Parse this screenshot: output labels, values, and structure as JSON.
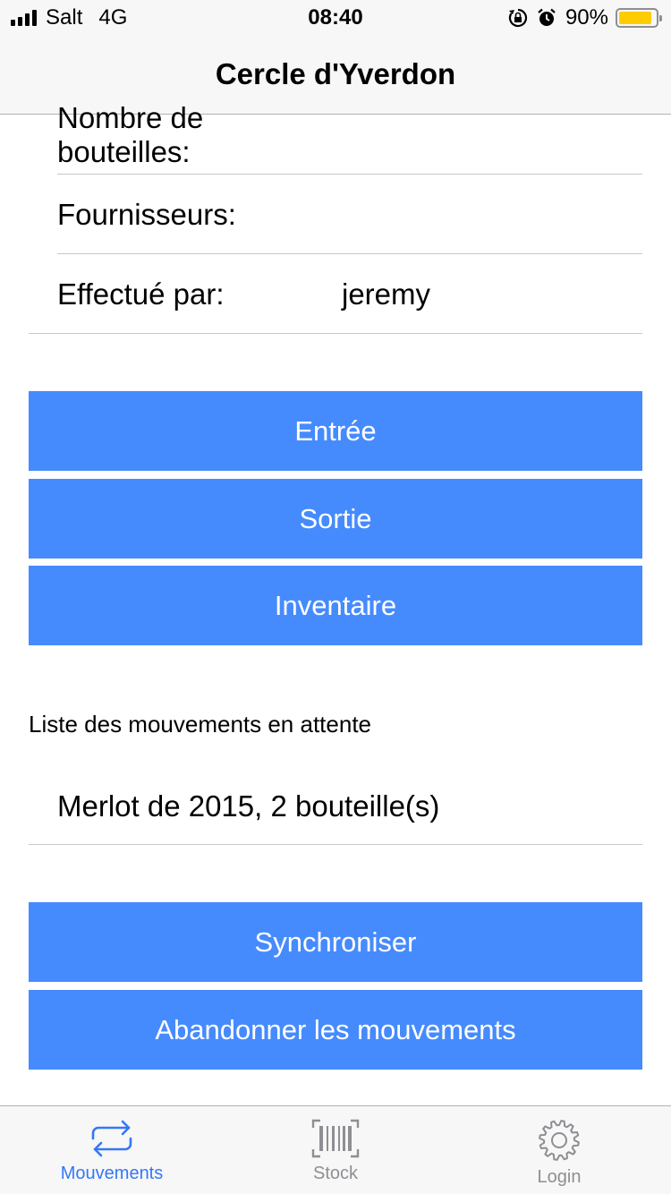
{
  "status_bar": {
    "carrier": "Salt",
    "network": "4G",
    "time": "08:40",
    "battery_percent": "90%",
    "battery_level": 0.9,
    "icons": [
      "orientation-lock-icon",
      "alarm-icon"
    ],
    "battery_color": "#ffcc00"
  },
  "nav": {
    "title": "Cercle d'Yverdon"
  },
  "form": {
    "bottles_label": "Nombre de bouteilles:",
    "bottles_value": "",
    "suppliers_label": "Fournisseurs:",
    "suppliers_value": "",
    "performed_by_label": "Effectué par:",
    "performed_by_value": "jeremy"
  },
  "actions": {
    "entry": "Entrée",
    "exit": "Sortie",
    "inventory": "Inventaire"
  },
  "pending": {
    "section_label": "Liste des mouvements en attente",
    "items": [
      "Merlot de 2015, 2 bouteille(s)"
    ]
  },
  "sync": {
    "synchronize": "Synchroniser",
    "abandon": "Abandonner les mouvements"
  },
  "tabs": [
    {
      "label": "Mouvements",
      "icon": "repeat-arrows-icon",
      "active": true
    },
    {
      "label": "Stock",
      "icon": "barcode-icon",
      "active": false
    },
    {
      "label": "Login",
      "icon": "gear-icon",
      "active": false
    }
  ],
  "colors": {
    "button": "#468bfd",
    "active_tab": "#3478f6",
    "inactive_tab": "#8e8e93"
  }
}
